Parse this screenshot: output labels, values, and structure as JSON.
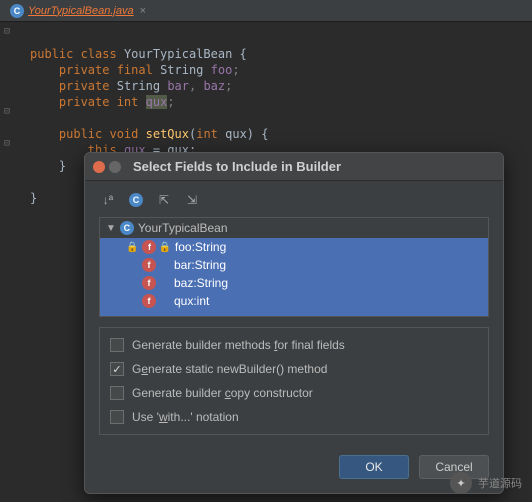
{
  "tab": {
    "icon": "C",
    "filename": "YourTypicalBean.java"
  },
  "code": {
    "l1": {
      "kw1": "public class",
      "name": "YourTypicalBean",
      "brace": " {"
    },
    "l2": {
      "kw": "private final",
      "type": "String",
      "field": "foo",
      "semi": ";"
    },
    "l3": {
      "kw": "private",
      "type": "String",
      "f1": "bar",
      "c": ", ",
      "f2": "baz",
      "semi": ";"
    },
    "l4": {
      "kw": "private int",
      "f": "qux",
      "semi": ";"
    },
    "l5": "",
    "l6": {
      "kw1": "public void",
      "name": "setQux",
      "paren": "(",
      "kw2": "int",
      "param": " qux) {"
    },
    "l7": {
      "kw": "this",
      "dot": ".",
      "f": "qux",
      "eq": " = qux;"
    },
    "l8": "    }",
    "l9": "",
    "l10": "}"
  },
  "dialog": {
    "title": "Select Fields to Include in Builder",
    "class_icon": "C",
    "class_name": "YourTypicalBean",
    "fields": [
      {
        "icon": "f",
        "locked": true,
        "name": "foo",
        "type": "String"
      },
      {
        "icon": "f",
        "locked": false,
        "name": "bar",
        "type": "String"
      },
      {
        "icon": "f",
        "locked": false,
        "name": "baz",
        "type": "String"
      },
      {
        "icon": "f",
        "locked": false,
        "name": "qux",
        "type": "int"
      }
    ],
    "options": [
      {
        "checked": false,
        "pre": "Generate builder methods ",
        "u": "f",
        "post": "or final fields"
      },
      {
        "checked": true,
        "pre": "G",
        "u": "e",
        "post": "nerate static newBuilder() method"
      },
      {
        "checked": false,
        "pre": "Generate builder ",
        "u": "c",
        "post": "opy constructor"
      },
      {
        "checked": false,
        "pre": "Use '",
        "u": "w",
        "post": "ith...' notation"
      }
    ],
    "ok": "OK",
    "cancel": "Cancel"
  },
  "watermark": "芋道源码"
}
